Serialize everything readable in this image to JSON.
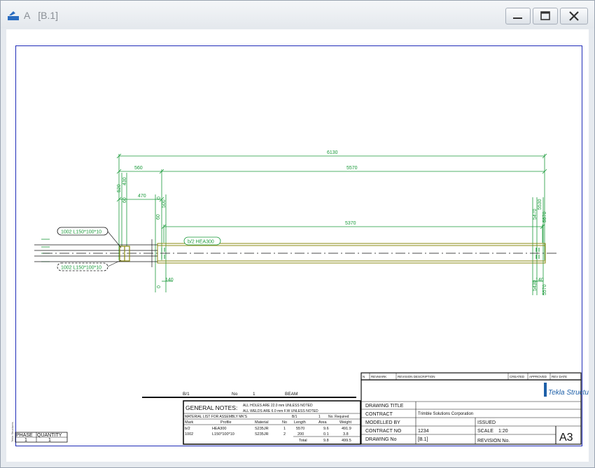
{
  "window": {
    "title_name": "A",
    "title_mark": "[B.1]",
    "minimize_label": "minimize-icon",
    "maximize_label": "maximize-icon",
    "close_label": "close-icon"
  },
  "drawing": {
    "dims": {
      "overall": "6130",
      "d560": "560",
      "d5570": "5570",
      "d470": "470",
      "d5370": "5370",
      "d430": "430",
      "d520": "520",
      "d60a": "60",
      "d60b": "60",
      "d500": "500",
      "d0a": "0",
      "d0b": "0",
      "d140a": "140",
      "d140b": "140",
      "d5470": "5470",
      "d5530": "5530",
      "d5570r": "5570",
      "d5430": "5430",
      "d5570r2": "5570"
    },
    "labels": {
      "upper_part": "1002  L150*100*10",
      "lower_part": "1002  L150*100*10",
      "main_part": "b/2  HEA300"
    },
    "bottom_header": {
      "mark": "B/1",
      "no_label": "No",
      "no_value": "1",
      "type": "BEAM"
    },
    "phase_table": {
      "phase_header": "PHASE",
      "qty_header": "QUANTITY",
      "phase_value": "1",
      "qty_value": "1"
    },
    "side_note": "Tekla Structures",
    "notes": {
      "title": "GENERAL NOTES:",
      "line1": "ALL HOLES ARE  22.0 mm UNLESS NOTED",
      "line2": "ALL WELDS ARE  6.0 mm F.W UNLESS NOTED",
      "material_list": "MATERIAL LIST FOR ASSEMBLY MK'S",
      "ml_mark": "B/1",
      "ml_count": "1",
      "ml_req": "No. Required",
      "headers": [
        "Mark",
        "Profile",
        "Material",
        "No",
        "Length",
        "Area",
        "Weight"
      ],
      "rows": [
        [
          "b/2",
          "HEA300",
          "S235JR",
          "1",
          "5570",
          "9.6",
          "491.9"
        ],
        [
          "1002",
          "L150*100*10",
          "S235JR",
          "2",
          "200",
          "0.1",
          "3.8"
        ]
      ],
      "total_label": "Total",
      "total_area": "9.8",
      "total_weight": "499.5"
    },
    "revision_block": {
      "no": "N",
      "revmark": "REVMARK",
      "desc": "REVISION DESCRIPTION",
      "created": "CREATED",
      "approved": "APPROVED",
      "revdate": "REV DATE"
    },
    "logo": "Tekla Structures",
    "title_block": {
      "drawing_title_label": "DRAWING TITLE",
      "contract_label": "CONTRACT",
      "contract_value": "Trimble Solutions Corporation",
      "modelled_by_label": "MODELLED BY",
      "issued_label": "ISSUED",
      "contract_no_label": "CONTRACT NO",
      "contract_no_value": "1234",
      "scale_label": "SCALE",
      "scale_value": "1:20",
      "drawing_no_label": "DRAWING No",
      "drawing_no_value": "[B.1]",
      "revision_label": "REVISION No.",
      "sheet_size": "A3"
    }
  },
  "colors": {
    "frame_blue": "#1f2bb8",
    "dim_green": "#1a9a3a",
    "part_olive": "#8a8a10",
    "ink": "#111111"
  }
}
